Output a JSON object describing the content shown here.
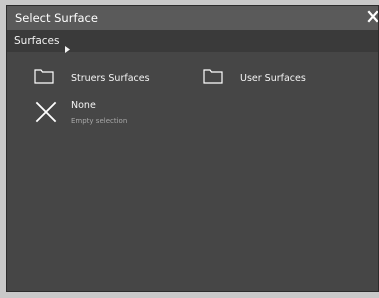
{
  "dialog": {
    "title": "Select Surface",
    "close_icon": "close-x-icon"
  },
  "breadcrumb": {
    "label": "Surfaces",
    "arrow_icon": "caret-right-icon"
  },
  "items": [
    {
      "name": "Struers Surfaces",
      "icon": "folder-icon"
    },
    {
      "name": "User Surfaces",
      "icon": "folder-icon"
    },
    {
      "name": "None",
      "subtitle": "Empty selection",
      "icon": "cross-icon"
    }
  ]
}
